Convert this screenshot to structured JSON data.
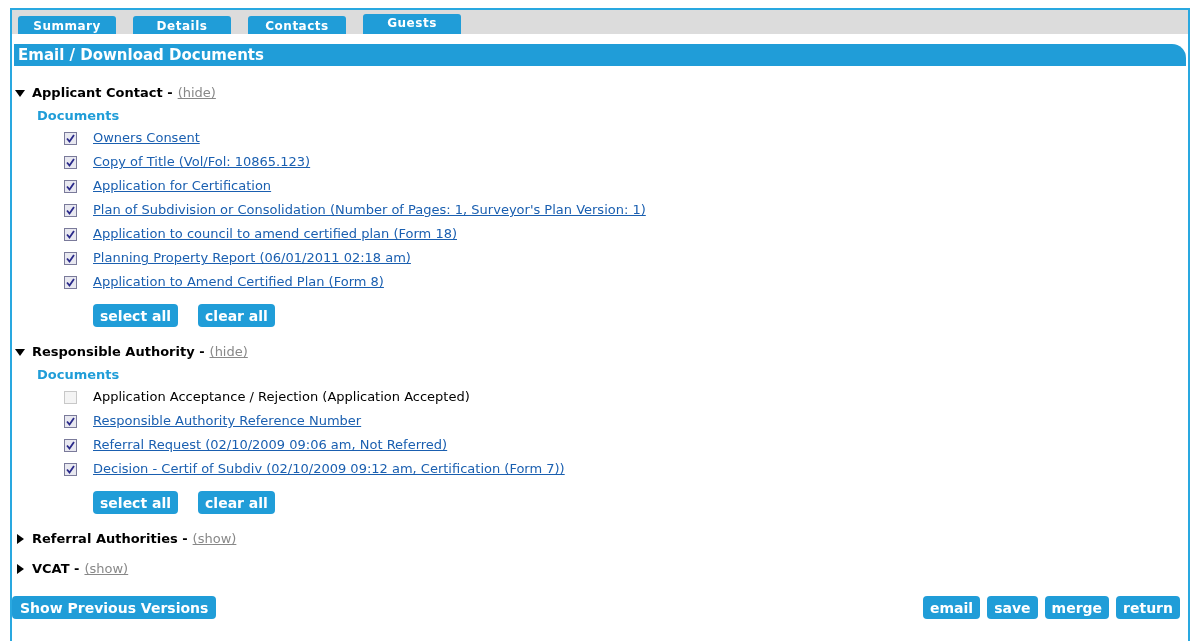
{
  "tabs": [
    {
      "label": "Summary",
      "selected": false
    },
    {
      "label": "Details",
      "selected": false
    },
    {
      "label": "Contacts",
      "selected": false
    },
    {
      "label": "Guests",
      "selected": true
    }
  ],
  "title": "Email / Download Documents",
  "sections": [
    {
      "name": "Applicant Contact -",
      "toggle": "(hide)",
      "expanded": true,
      "subheading": "Documents",
      "documents": [
        {
          "label": "Owners Consent",
          "checked": true,
          "link": true
        },
        {
          "label": "Copy of Title (Vol/Fol: 10865.123)",
          "checked": true,
          "link": true
        },
        {
          "label": "Application for Certification",
          "checked": true,
          "link": true
        },
        {
          "label": "Plan of Subdivision or Consolidation (Number of Pages: 1, Surveyor's Plan Version: 1)",
          "checked": true,
          "link": true
        },
        {
          "label": "Application to council to amend certified plan (Form 18)",
          "checked": true,
          "link": true
        },
        {
          "label": "Planning Property Report (06/01/2011 02:18 am)",
          "checked": true,
          "link": true
        },
        {
          "label": "Application to Amend Certified Plan (Form 8)",
          "checked": true,
          "link": true
        }
      ],
      "buttons": [
        "select all",
        "clear all"
      ]
    },
    {
      "name": "Responsible Authority -",
      "toggle": "(hide)",
      "expanded": true,
      "subheading": "Documents",
      "documents": [
        {
          "label": "Application Acceptance / Rejection (Application Accepted)",
          "checked": false,
          "link": false
        },
        {
          "label": "Responsible Authority Reference Number",
          "checked": true,
          "link": true
        },
        {
          "label": "Referral Request (02/10/2009 09:06 am, Not Referred)",
          "checked": true,
          "link": true
        },
        {
          "label": "Decision - Certif of Subdiv (02/10/2009 09:12 am, Certification (Form 7))",
          "checked": true,
          "link": true
        }
      ],
      "buttons": [
        "select all",
        "clear all"
      ]
    },
    {
      "name": "Referral Authorities -",
      "toggle": "(show)",
      "expanded": false
    },
    {
      "name": "VCAT -",
      "toggle": "(show)",
      "expanded": false
    }
  ],
  "footer": {
    "left": "Show Previous Versions",
    "right": [
      "email",
      "save",
      "merge",
      "return"
    ]
  }
}
